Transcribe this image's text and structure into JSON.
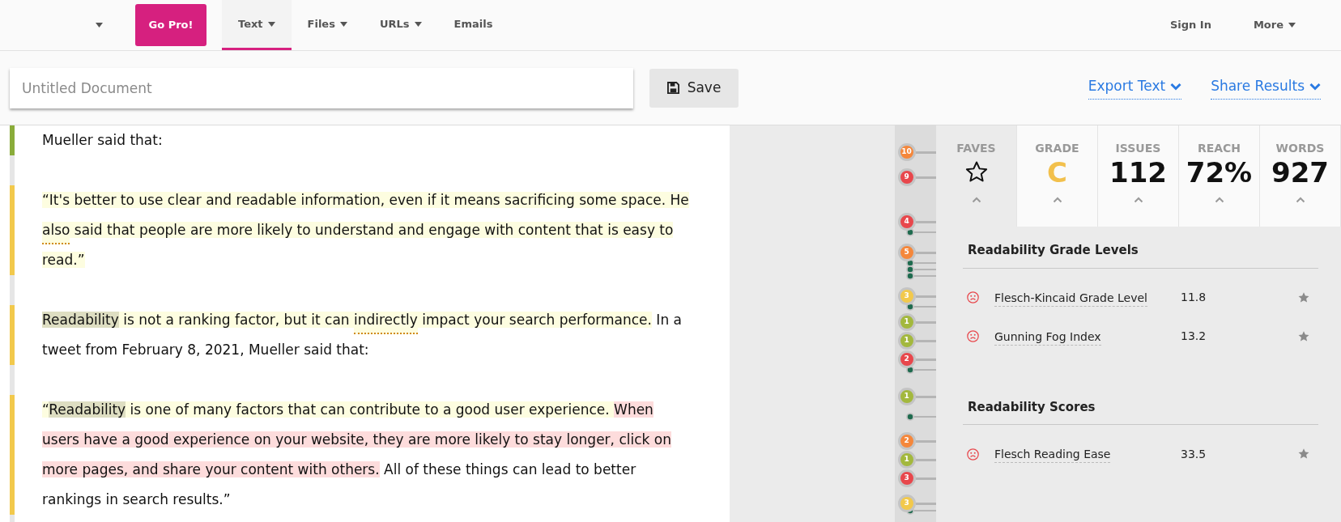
{
  "nav": {
    "promo_button": "Go Pro!",
    "tabs": [
      {
        "label": "Text",
        "selected": true
      },
      {
        "label": "Files",
        "selected": false
      },
      {
        "label": "URLs",
        "selected": false
      },
      {
        "label": "Emails",
        "selected": false
      }
    ],
    "right": [
      {
        "label": "Sign In",
        "has_menu": false
      },
      {
        "label": "More",
        "has_menu": true
      }
    ]
  },
  "toolbar": {
    "title_placeholder": "Untitled Document",
    "save": "Save",
    "links": [
      "Export Text",
      "Share Results"
    ]
  },
  "document": {
    "paragraphs": [
      {
        "color": "#8aac3a",
        "segments": [
          {
            "text": "Mueller said that:",
            "kind": "plain",
            "underline": false
          }
        ]
      },
      {
        "color": "#f2c94c",
        "segments": [
          {
            "text": "“It's better to use clear and readable information, even if it means sacrificing some space. ",
            "kind": "hard",
            "underline": false
          },
          {
            "text": "He ",
            "kind": "hard",
            "underline": false
          },
          {
            "text": "also",
            "kind": "hard",
            "underline": true
          },
          {
            "text": " said that people are more likely to understand and engage with content that is easy to read.”",
            "kind": "hard",
            "underline": false
          }
        ]
      },
      {
        "color": "#f2c94c",
        "segments": [
          {
            "text": "Readability",
            "kind": "word",
            "underline": false
          },
          {
            "text": " is not a ranking factor, but it can ",
            "kind": "hard",
            "underline": false
          },
          {
            "text": "indirectly",
            "kind": "hard",
            "underline": true
          },
          {
            "text": " impact your search performance.",
            "kind": "hard",
            "underline": false
          },
          {
            "text": " In a tweet from February 8, 2021, Mueller said that:",
            "kind": "plain",
            "underline": false
          }
        ]
      },
      {
        "color": "#f2c94c",
        "segments": [
          {
            "text": "“",
            "kind": "hard",
            "underline": false
          },
          {
            "text": "Readability",
            "kind": "word",
            "underline": false
          },
          {
            "text": " is one of many factors that can contribute to a good user experience. ",
            "kind": "hard",
            "underline": false
          },
          {
            "text": "When users have a good experience on your website, they are more likely to stay longer, click on more pages, and share your content with others.",
            "kind": "very_hard",
            "underline": false
          },
          {
            "text": " All of these things can lead to better rankings in search results.”",
            "kind": "plain",
            "underline": false
          }
        ]
      }
    ]
  },
  "minimap": {
    "markers": [
      {
        "label": "10",
        "color": "#f5873b"
      },
      {
        "label": "9",
        "color": "#e8474c"
      },
      {
        "label": "4",
        "color": "#e8474c"
      },
      {
        "label": "5",
        "color": "#f5873b"
      },
      {
        "label": "3",
        "color": "#f2c94c"
      },
      {
        "label": "1",
        "color": "#a3b83d"
      },
      {
        "label": "1",
        "color": "#a3b83d"
      },
      {
        "label": "2",
        "color": "#e8474c"
      },
      {
        "label": "1",
        "color": "#a3b83d"
      },
      {
        "label": "2",
        "color": "#f5873b"
      },
      {
        "label": "1",
        "color": "#a3b83d"
      },
      {
        "label": "3",
        "color": "#e8474c"
      },
      {
        "label": "3",
        "color": "#f2c94c"
      }
    ]
  },
  "stats": [
    {
      "label": "FAVES",
      "kind": "star",
      "selected": true
    },
    {
      "label": "GRADE",
      "kind": "grade",
      "value": "C",
      "selected": false
    },
    {
      "label": "ISSUES",
      "kind": "number",
      "value": "112",
      "selected": false
    },
    {
      "label": "REACH",
      "kind": "number",
      "value": "72%",
      "selected": false
    },
    {
      "label": "WORDS",
      "kind": "number",
      "value": "927",
      "selected": false
    }
  ],
  "sections": [
    {
      "title": "Readability Grade Levels",
      "rows": [
        {
          "name": "Flesch-Kincaid Grade Level",
          "value": "11.8",
          "kind": "bad"
        },
        {
          "name": "Gunning Fog Index",
          "value": "13.2",
          "kind": "bad"
        }
      ]
    },
    {
      "title": "Readability Scores",
      "rows": [
        {
          "name": "Flesch Reading Ease",
          "value": "33.5",
          "kind": "bad"
        }
      ]
    }
  ]
}
